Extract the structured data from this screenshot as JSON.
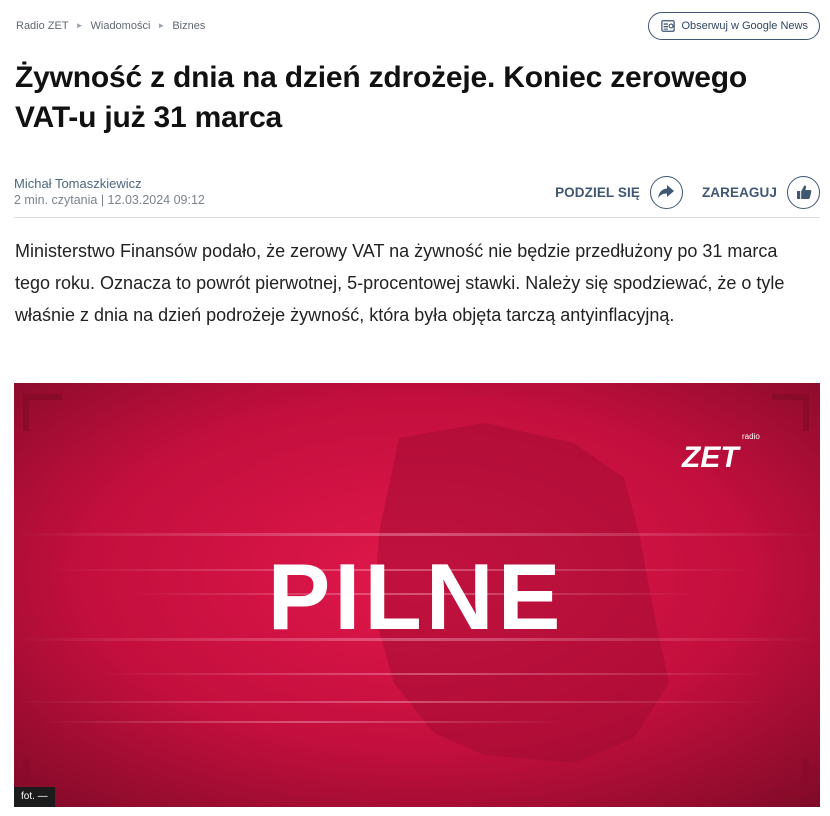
{
  "breadcrumb": {
    "items": [
      "Radio ZET",
      "Wiadomości",
      "Biznes"
    ]
  },
  "follow_button": {
    "label": "Obserwuj w Google News"
  },
  "article": {
    "title": "Żywność z dnia na dzień zdrożeje. Koniec zerowego VAT-u już 31 marca",
    "author": "Michał Tomaszkiewicz",
    "read_info": "2 min. czytania | 12.03.2024 09:12",
    "lead": "Ministerstwo Finansów podało, że zerowy VAT na żywność nie będzie przedłużony po 31 marca tego roku. Oznacza to powrót pierwotnej, 5-procentowej stawki. Należy się spodziewać, że o tyle właśnie z dnia na dzień podrożeje żywność, która była objęta tarczą antyinflacyjną."
  },
  "actions": {
    "share_label": "PODZIEL SIĘ",
    "react_label": "ZAREAGUJ"
  },
  "hero_image": {
    "headline": "PILNE",
    "logo_text": "ZET",
    "logo_small": "radio",
    "caption": "fot. —"
  },
  "icons": {
    "crumb_separator": "triangle-right-icon",
    "follow": "google-news-icon",
    "share": "share-arrow-icon",
    "react": "thumbs-up-icon"
  },
  "colors": {
    "accent": "#3f5773",
    "hero_red": "#c8103f",
    "caption_bg": "#1c1c1c"
  }
}
